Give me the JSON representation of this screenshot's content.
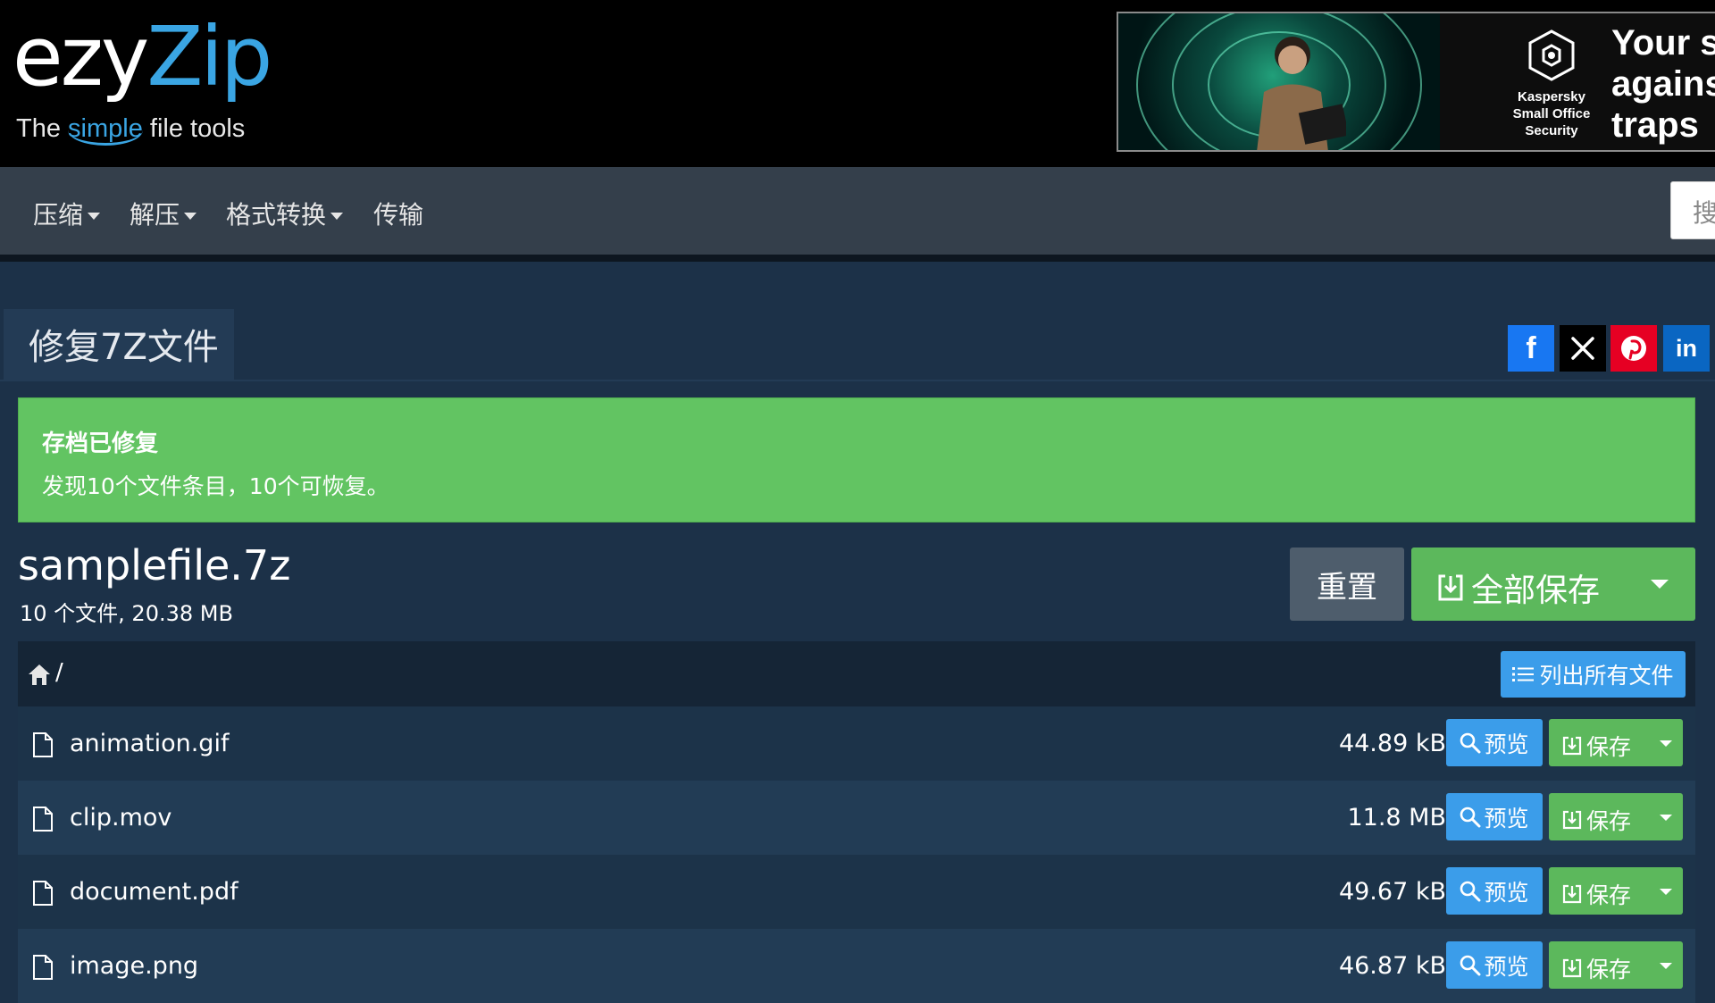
{
  "logo": {
    "main_a": "ezy",
    "main_b": "Zip",
    "tagline_a": "The ",
    "tagline_b": "simple",
    "tagline_c": " file tools"
  },
  "ad": {
    "brand": "Kaspersky\nSmall Office\nSecurity",
    "slogan": "Your s\nagains\ntraps"
  },
  "nav": {
    "items": [
      {
        "label": "压缩",
        "dropdown": true
      },
      {
        "label": "解压",
        "dropdown": true
      },
      {
        "label": "格式转换",
        "dropdown": true
      },
      {
        "label": "传输",
        "dropdown": false
      }
    ],
    "search_placeholder": "搜"
  },
  "page": {
    "tab_title": "修复7Z文件"
  },
  "social": {
    "facebook": "f",
    "linkedin": "in"
  },
  "alert": {
    "title": "存档已修复",
    "text": "发现10个文件条目，10个可恢复。",
    "color": "#62c462"
  },
  "archive": {
    "name": "samplefile.7z",
    "meta": "10 个文件, 20.38 MB",
    "reset_label": "重置",
    "save_all_label": "全部保存"
  },
  "browser": {
    "path": "/",
    "list_all_label": "列出所有文件",
    "preview_label": "预览",
    "save_label": "保存",
    "files": [
      {
        "name": "animation.gif",
        "size": "44.89 kB"
      },
      {
        "name": "clip.mov",
        "size": "11.8 MB"
      },
      {
        "name": "document.pdf",
        "size": "49.67 kB"
      },
      {
        "name": "image.png",
        "size": "46.87 kB"
      }
    ]
  },
  "colors": {
    "primary": "#3b9dea",
    "success": "#5cb85c",
    "navbar": "#343f4b",
    "body": "#1c3148"
  }
}
